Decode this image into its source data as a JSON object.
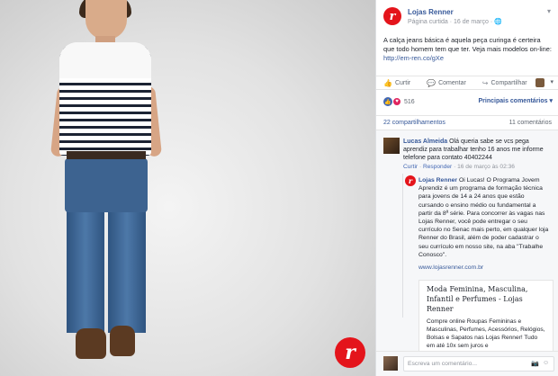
{
  "post": {
    "page_name": "Lojas Renner",
    "meta": "Página curtida · 16 de março · ",
    "text": "A calça jeans básica é aquela peça curinga é certeira que todo homem tem que ter. Veja mais modelos on-line: ",
    "link": "http://em-ren.co/gXe",
    "logo_letter": "r",
    "brand_color": "#e4141b"
  },
  "actions": {
    "like": "Curtir",
    "comment": "Comentar",
    "share": "Compartilhar",
    "like_icon": "thumbs-up-icon",
    "comment_icon": "speech-bubble-icon",
    "share_icon": "share-arrow-icon"
  },
  "reactions": {
    "count": "516",
    "relevant": "Principais comentários ▾"
  },
  "counts": {
    "shares": "22 compartilhamentos",
    "comments": "11 comentários"
  },
  "comments": [
    {
      "author": "Lucas Almeida",
      "text": "Olá queria sabe se vcs pega aprendiz para trabalhar tenho 16 anos me informe telefone para contato 40402244",
      "like": "Curtir",
      "reply": "Responder",
      "time": "16 de março às 02:36"
    },
    {
      "author": "Lojas Renner",
      "text": "Oi Lucas! O Programa Jovem Aprendiz é um programa de formação técnica para jovens de 14 a 24 anos que estão cursando o ensino médio ou fundamental a partir da 8ª série. Para concorrer às vagas nas Lojas Renner, você pode entregar o seu currículo no Senac mais perto, em qualquer loja Renner do Brasil, além de poder cadastrar o seu currículo em nosso site, na aba \"Trabalhe Conosco\".",
      "link": "www.lojasrenner.com.br",
      "preview_title": "Moda Feminina, Masculina, Infantil e Perfumes - Lojas Renner",
      "preview_desc": "Compre online Roupas Femininas e Masculinas, Perfumes, Acessórios, Relógios, Bolsas e Sapatos nas Lojas Renner! Tudo em até 10x sem juros e"
    }
  ],
  "composer": {
    "placeholder": "Escreva um comentário...",
    "camera_icon": "camera-icon",
    "emoji_icon": "emoji-icon"
  }
}
